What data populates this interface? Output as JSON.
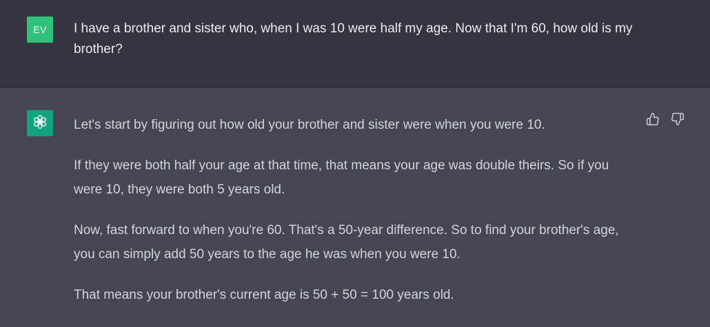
{
  "user_message": {
    "avatar_initials": "EV",
    "avatar_color": "#2fc27a",
    "text": "I have a brother and sister who, when I was 10 were half my age. Now that I'm 60, how old is my brother?"
  },
  "assistant_message": {
    "avatar_icon": "openai-logo-icon",
    "avatar_color": "#10a37f",
    "paragraphs": [
      "Let's start by figuring out how old your brother and sister were when you were 10.",
      "If they were both half your age at that time, that means your age was double theirs. So if you were 10, they were both 5 years old.",
      "Now, fast forward to when you're 60. That's a 50-year difference. So to find your brother's age, you can simply add 50 years to the age he was when you were 10.",
      "That means your brother's current age is 50 + 50 = 100 years old."
    ],
    "feedback": {
      "thumbs_up_icon": "thumbs-up-icon",
      "thumbs_down_icon": "thumbs-down-icon"
    }
  },
  "colors": {
    "user_bg": "#343541",
    "assistant_bg": "#444654",
    "text": "#ececf1"
  }
}
